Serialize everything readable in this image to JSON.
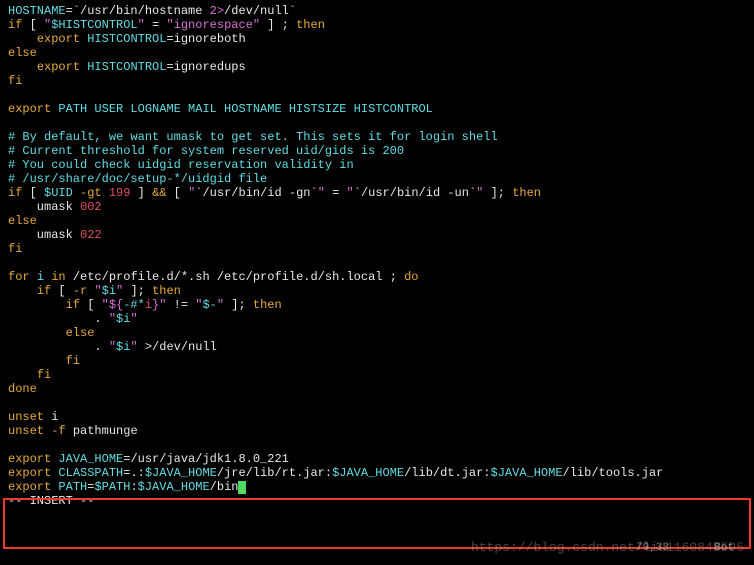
{
  "code": {
    "l1a": "HOSTNAME",
    "l1b": "=",
    "l1c": "`",
    "l1d": "/usr/bin/hostname ",
    "l1e": "2>",
    "l1f": "/dev/null",
    "l1g": "`",
    "l2a": "if ",
    "l2b": "[ ",
    "l2c": "\"",
    "l2d": "$HISTCONTROL",
    "l2e": "\"",
    "l2f": " = ",
    "l2g": "\"ignorespace\"",
    "l2h": " ] ",
    "l2i": "; ",
    "l2j": "then",
    "l3a": "    ",
    "l3b": "export ",
    "l3c": "HISTCONTROL",
    "l3d": "=",
    "l3e": "ignoreboth",
    "l4a": "else",
    "l5a": "    ",
    "l5b": "export ",
    "l5c": "HISTCONTROL",
    "l5d": "=",
    "l5e": "ignoredups",
    "l6a": "fi",
    "l7": "",
    "l8a": "export ",
    "l8b": "PATH USER LOGNAME MAIL HOSTNAME HISTSIZE HISTCONTROL",
    "l9": "",
    "l10": "# By default, we want umask to get set. This sets it for login shell",
    "l11": "# Current threshold for system reserved uid/gids is 200",
    "l12": "# You could check uidgid reservation validity in",
    "l13": "# /usr/share/doc/setup-*/uidgid file",
    "l14a": "if ",
    "l14b": "[ ",
    "l14c": "$UID ",
    "l14d": "-gt",
    "l14e": " 199 ",
    "l14f": "] ",
    "l14g": "&& ",
    "l14h": "[ ",
    "l14i": "\"",
    "l14j": "`",
    "l14k": "/usr/bin/id -gn",
    "l14l": "`",
    "l14m": "\"",
    "l14n": " = ",
    "l14o": "\"",
    "l14p": "`",
    "l14q": "/usr/bin/id -un",
    "l14r": "`",
    "l14s": "\"",
    "l14t": " ]",
    "l14u": "; ",
    "l14v": "then",
    "l15a": "    umask ",
    "l15b": "002",
    "l16a": "else",
    "l17a": "    umask ",
    "l17b": "022",
    "l18a": "fi",
    "l19": "",
    "l20a": "for ",
    "l20b": "i ",
    "l20c": "in ",
    "l20d": "/etc/profile.d/*.sh /etc/profile.d/sh.local ",
    "l20e": "; ",
    "l20f": "do",
    "l21a": "    ",
    "l21b": "if ",
    "l21c": "[ ",
    "l21d": "-r ",
    "l21e": "\"",
    "l21f": "$i",
    "l21g": "\" ",
    "l21h": "]",
    "l21i": "; ",
    "l21j": "then",
    "l22a": "        ",
    "l22b": "if ",
    "l22c": "[ ",
    "l22d": "\"",
    "l22e": "${",
    "l22f": "-#*",
    "l22g": "i",
    "l22h": "}",
    "l22i": "\"",
    "l22j": " != ",
    "l22k": "\"",
    "l22l": "$-",
    "l22m": "\"",
    "l22n": " ]",
    "l22o": "; ",
    "l22p": "then",
    "l23a": "            ",
    "l23b": ". ",
    "l23c": "\"",
    "l23d": "$i",
    "l23e": "\"",
    "l24a": "        ",
    "l24b": "else",
    "l25a": "            ",
    "l25b": ". ",
    "l25c": "\"",
    "l25d": "$i",
    "l25e": "\" ",
    "l25f": ">",
    "l25g": "/dev/null",
    "l26a": "        ",
    "l26b": "fi",
    "l27a": "    ",
    "l27b": "fi",
    "l28a": "done",
    "l29": "",
    "l30a": "unset ",
    "l30b": "i",
    "l31a": "unset ",
    "l31b": "-f ",
    "l31c": "pathmunge",
    "l32": "",
    "l33a": "export ",
    "l33b": "JAVA_HOME",
    "l33c": "=",
    "l33d": "/usr/java/jdk1.8.0_221",
    "l34a": "export ",
    "l34b": "CLASSPATH",
    "l34c": "=",
    "l34d": ".:",
    "l34e": "$JAVA_HOME",
    "l34f": "/jre/lib/rt.jar:",
    "l34g": "$JAVA_HOME",
    "l34h": "/lib/dt.jar:",
    "l34i": "$JAVA_HOME",
    "l34j": "/lib/tools.jar",
    "l35a": "export ",
    "l35b": "PATH",
    "l35c": "=",
    "l35d": "$PATH",
    "l35e": ":",
    "l35f": "$JAVA_HOME",
    "l35g": "/bin"
  },
  "status": {
    "mode": "-- INSERT --",
    "pos": "79,33",
    "loc": "Bot"
  },
  "watermark": "https://blog.csdn.net/liu1160848595"
}
